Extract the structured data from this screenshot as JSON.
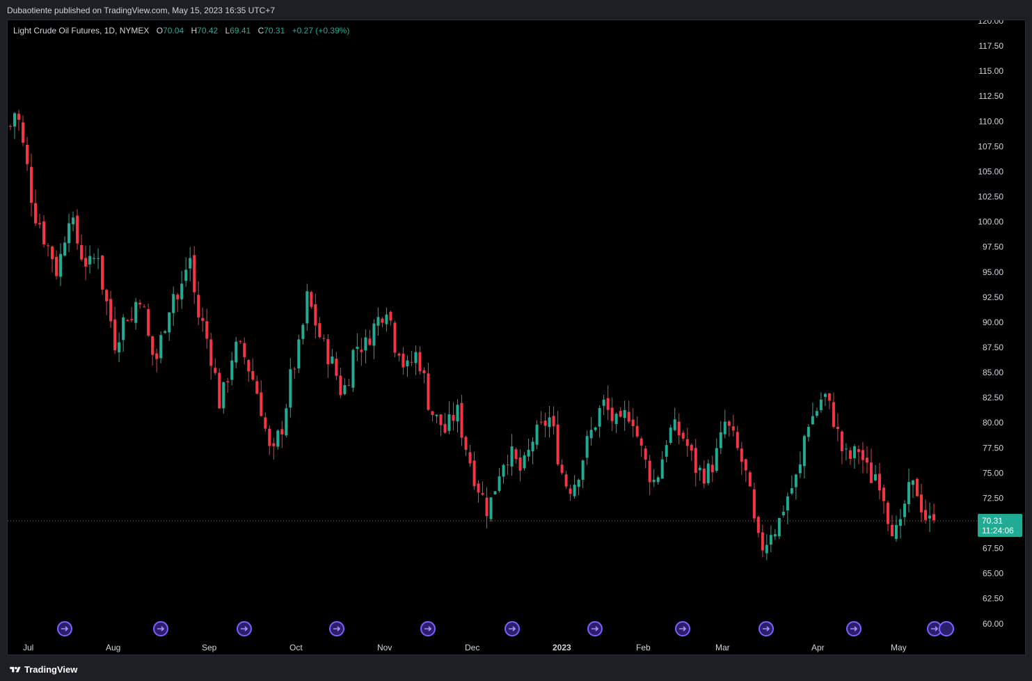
{
  "header": {
    "published_text": "Dubaotiente published on TradingView.com, May 15, 2023 16:35 UTC+7"
  },
  "legend": {
    "symbol": "Light Crude Oil Futures, 1D, NYMEX",
    "o_label": "O",
    "o_value": "70.04",
    "h_label": "H",
    "h_value": "70.42",
    "l_label": "L",
    "l_value": "69.41",
    "c_label": "C",
    "c_value": "70.31",
    "change": "+0.27 (+0.39%)"
  },
  "price_tag": {
    "price": "70.31",
    "countdown": "11:24:06"
  },
  "footer": {
    "brand": "TradingView"
  },
  "colors": {
    "up": "#22ab94",
    "down": "#f23645",
    "event": "#7b61ff",
    "bg": "#000000"
  },
  "chart_data": {
    "type": "candlestick",
    "y_ticks": [
      "120.00",
      "117.50",
      "115.00",
      "112.50",
      "110.00",
      "107.50",
      "105.00",
      "102.50",
      "100.00",
      "97.50",
      "95.00",
      "92.50",
      "90.00",
      "87.50",
      "85.00",
      "82.50",
      "80.00",
      "77.50",
      "75.00",
      "72.50",
      "67.50",
      "65.00",
      "62.50",
      "60.00"
    ],
    "ylim": [
      60,
      120
    ],
    "x_labels": [
      "Jul",
      "Aug",
      "Sep",
      "Oct",
      "Nov",
      "Dec",
      "2023",
      "Feb",
      "Mar",
      "Apr",
      "May"
    ],
    "last_price": 70.31,
    "event_markers": [
      {
        "icon": "arrow-event-icon"
      },
      {
        "icon": "arrow-event-icon"
      },
      {
        "icon": "arrow-event-icon"
      },
      {
        "icon": "arrow-event-icon"
      },
      {
        "icon": "arrow-event-icon"
      },
      {
        "icon": "arrow-event-icon"
      },
      {
        "icon": "arrow-event-icon"
      },
      {
        "icon": "arrow-event-icon"
      },
      {
        "icon": "arrow-event-icon"
      },
      {
        "icon": "arrow-event-icon"
      },
      {
        "icon": "arrow-event-icon"
      },
      {
        "icon": "lightning-event-icon"
      },
      {
        "icon": "arrow-event-icon"
      }
    ],
    "close_path": [
      [
        109.5,
        111.5
      ],
      [
        108.0,
        105.0
      ],
      [
        101.0,
        100.0
      ],
      [
        98.0,
        97.0
      ],
      [
        95.0,
        97.5
      ],
      [
        101.0,
        99.0
      ],
      [
        97.0,
        96.0
      ],
      [
        95.5,
        97.5
      ],
      [
        93.0,
        91.0
      ],
      [
        88.0,
        89.5
      ],
      [
        91.0,
        90.0
      ],
      [
        93.5,
        91.0
      ],
      [
        87.5,
        86.0
      ],
      [
        88.5,
        91.0
      ],
      [
        93.0,
        92.0
      ],
      [
        95.0,
        96.5
      ],
      [
        91.0,
        90.0
      ],
      [
        88.0,
        85.5
      ],
      [
        82.0,
        83.5
      ],
      [
        86.5,
        87.5
      ],
      [
        87.0,
        85.5
      ],
      [
        84.0,
        82.0
      ],
      [
        79.0,
        76.0
      ],
      [
        78.5,
        80.0
      ],
      [
        84.0,
        86.0
      ],
      [
        88.0,
        92.5
      ],
      [
        91.0,
        89.0
      ],
      [
        87.5,
        86.5
      ],
      [
        85.0,
        83.0
      ],
      [
        84.0,
        87.0
      ],
      [
        88.0,
        87.5
      ],
      [
        89.0,
        90.0
      ],
      [
        91.0,
        92.0
      ],
      [
        88.0,
        87.5
      ],
      [
        85.0,
        86.0
      ],
      [
        87.0,
        85.0
      ],
      [
        82.0,
        80.5
      ],
      [
        80.0,
        79.0
      ],
      [
        80.5,
        81.0
      ],
      [
        78.5,
        76.5
      ],
      [
        74.5,
        73.0
      ],
      [
        71.5,
        72.5
      ],
      [
        75.0,
        76.5
      ],
      [
        77.0,
        76.0
      ],
      [
        75.0,
        76.5
      ],
      [
        78.5,
        79.0
      ],
      [
        80.0,
        80.5
      ],
      [
        77.5,
        75.0
      ],
      [
        73.5,
        74.0
      ],
      [
        75.5,
        77.5
      ],
      [
        79.0,
        80.5
      ],
      [
        82.0,
        81.0
      ],
      [
        80.0,
        79.5
      ],
      [
        81.0,
        81.0
      ],
      [
        78.5,
        76.5
      ],
      [
        75.0,
        74.0
      ],
      [
        76.0,
        78.5
      ],
      [
        79.5,
        79.0
      ],
      [
        78.5,
        77.0
      ],
      [
        75.5,
        75.0
      ],
      [
        75.0,
        76.0
      ],
      [
        77.5,
        80.0
      ],
      [
        79.0,
        77.5
      ],
      [
        76.0,
        74.0
      ],
      [
        70.0,
        67.5
      ],
      [
        68.0,
        69.5
      ],
      [
        69.5,
        71.5
      ],
      [
        73.0,
        74.0
      ],
      [
        75.5,
        80.0
      ],
      [
        80.5,
        81.5
      ],
      [
        83.0,
        81.5
      ],
      [
        80.0,
        77.5
      ],
      [
        76.5,
        76.5
      ],
      [
        77.5,
        76.0
      ],
      [
        74.5,
        75.0
      ],
      [
        74.0,
        71.0
      ],
      [
        69.5,
        68.5
      ],
      [
        72.0,
        73.5
      ],
      [
        73.5,
        71.5
      ],
      [
        70.0,
        70.3
      ]
    ]
  }
}
